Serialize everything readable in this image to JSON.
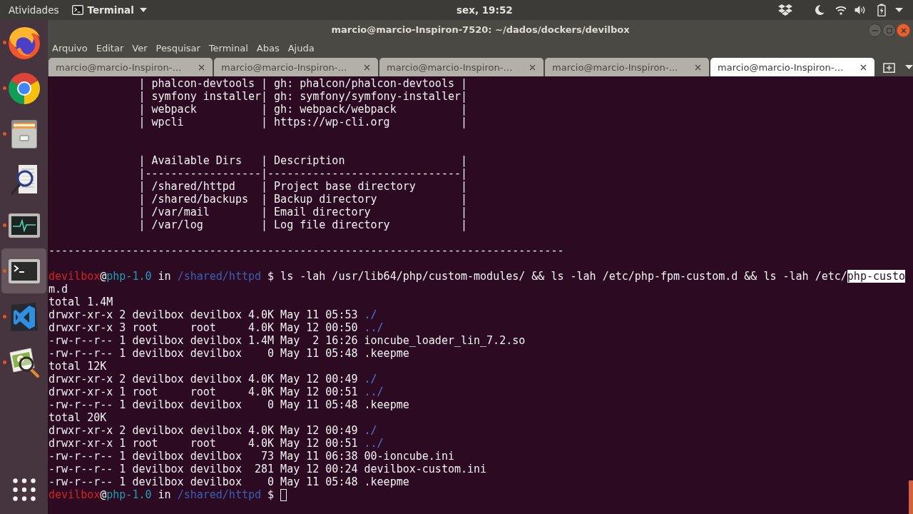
{
  "top_bar": {
    "activities": "Atividades",
    "app_menu": "Terminal",
    "clock": "sex, 19:52"
  },
  "dock": {
    "items": [
      {
        "kind": "fox",
        "running": true,
        "selected": false
      },
      {
        "kind": "ring",
        "running": true,
        "selected": false
      },
      {
        "kind": "cabinet",
        "running": true,
        "selected": false
      },
      {
        "kind": "scanner",
        "running": false,
        "selected": false
      },
      {
        "kind": "monitor",
        "running": true,
        "selected": false
      },
      {
        "kind": "prompt",
        "running": true,
        "selected": true
      },
      {
        "kind": "editor",
        "running": true,
        "selected": false
      },
      {
        "kind": "viewer",
        "running": true,
        "selected": false
      }
    ]
  },
  "window": {
    "title": "marcio@marcio-Inspiron-7520: ~/dados/dockers/devilbox"
  },
  "menu": [
    "Arquivo",
    "Editar",
    "Ver",
    "Pesquisar",
    "Terminal",
    "Abas",
    "Ajuda"
  ],
  "tabs": [
    {
      "label": "marcio@marcio-Inspiron-…",
      "selected": false
    },
    {
      "label": "marcio@marcio-Inspiron-…",
      "selected": false
    },
    {
      "label": "marcio@marcio-Inspiron-…",
      "selected": false
    },
    {
      "label": "marcio@marcio-Inspiron-…",
      "selected": false
    },
    {
      "label": "marcio@marcio-Inspiron-…",
      "selected": true
    }
  ],
  "terminal": {
    "lines": [
      {
        "kind": "text",
        "text": "              | phalcon-devtools | gh: phalcon/phalcon-devtools |"
      },
      {
        "kind": "text",
        "text": "              | symfony installer| gh: symfony/symfony-installer|"
      },
      {
        "kind": "text",
        "text": "              | webpack          | gh: webpack/webpack          |"
      },
      {
        "kind": "text",
        "text": "              | wpcli            | https://wp-cli.org           |"
      },
      {
        "kind": "blank"
      },
      {
        "kind": "blank"
      },
      {
        "kind": "text",
        "text": "              | Available Dirs   | Description                  |"
      },
      {
        "kind": "text",
        "text": "              |------------------|------------------------------|"
      },
      {
        "kind": "text",
        "text": "              | /shared/httpd    | Project base directory       |"
      },
      {
        "kind": "text",
        "text": "              | /shared/backups  | Backup directory             |"
      },
      {
        "kind": "text",
        "text": "              | /var/mail        | Email directory              |"
      },
      {
        "kind": "text",
        "text": "              | /var/log         | Log file directory           |"
      },
      {
        "kind": "blank"
      },
      {
        "kind": "text",
        "text": "--------------------------------------------------------------------------------"
      },
      {
        "kind": "blank"
      },
      {
        "kind": "colored",
        "segments": [
          {
            "kind": "user",
            "text": "devilbox"
          },
          {
            "kind": "plain",
            "text": "@"
          },
          {
            "kind": "host",
            "text": "php-1.0"
          },
          {
            "kind": "plain",
            "text": " in "
          },
          {
            "kind": "path",
            "text": "/shared/httpd"
          },
          {
            "kind": "plain",
            "text": " $ ls -lah /usr/lib64/php/custom-modules/ && ls -lah /etc/php-fpm-custom.d && ls -lah /etc/"
          },
          {
            "kind": "highlight",
            "text": "php-custo"
          }
        ]
      },
      {
        "kind": "text",
        "text": "m.d"
      },
      {
        "kind": "text",
        "text": "total 1.4M"
      },
      {
        "kind": "colored",
        "segments": [
          {
            "kind": "plain",
            "text": "drwxr-xr-x 2 devilbox devilbox 4.0K May 11 05:53 "
          },
          {
            "kind": "dir",
            "text": "./"
          }
        ]
      },
      {
        "kind": "colored",
        "segments": [
          {
            "kind": "plain",
            "text": "drwxr-xr-x 3 root     root     4.0K May 12 00:50 "
          },
          {
            "kind": "dir",
            "text": "../"
          }
        ]
      },
      {
        "kind": "text",
        "text": "-rw-r--r-- 1 devilbox devilbox 1.4M May  2 16:26 ioncube_loader_lin_7.2.so"
      },
      {
        "kind": "text",
        "text": "-rw-r--r-- 1 devilbox devilbox    0 May 11 05:48 .keepme"
      },
      {
        "kind": "text",
        "text": "total 12K"
      },
      {
        "kind": "colored",
        "segments": [
          {
            "kind": "plain",
            "text": "drwxr-xr-x 2 devilbox devilbox 4.0K May 12 00:49 "
          },
          {
            "kind": "dir",
            "text": "./"
          }
        ]
      },
      {
        "kind": "colored",
        "segments": [
          {
            "kind": "plain",
            "text": "drwxr-xr-x 1 root     root     4.0K May 12 00:51 "
          },
          {
            "kind": "dir",
            "text": "../"
          }
        ]
      },
      {
        "kind": "text",
        "text": "-rw-r--r-- 1 devilbox devilbox    0 May 11 05:48 .keepme"
      },
      {
        "kind": "text",
        "text": "total 20K"
      },
      {
        "kind": "colored",
        "segments": [
          {
            "kind": "plain",
            "text": "drwxr-xr-x 2 devilbox devilbox 4.0K May 12 00:49 "
          },
          {
            "kind": "dir",
            "text": "./"
          }
        ]
      },
      {
        "kind": "colored",
        "segments": [
          {
            "kind": "plain",
            "text": "drwxr-xr-x 1 root     root     4.0K May 12 00:51 "
          },
          {
            "kind": "dir",
            "text": "../"
          }
        ]
      },
      {
        "kind": "text",
        "text": "-rw-r--r-- 1 devilbox devilbox   73 May 11 06:38 00-ioncube.ini"
      },
      {
        "kind": "text",
        "text": "-rw-r--r-- 1 devilbox devilbox  281 May 12 00:24 devilbox-custom.ini"
      },
      {
        "kind": "text",
        "text": "-rw-r--r-- 1 devilbox devilbox    0 May 11 05:48 .keepme"
      },
      {
        "kind": "colored",
        "segments": [
          {
            "kind": "user",
            "text": "devilbox"
          },
          {
            "kind": "plain",
            "text": "@"
          },
          {
            "kind": "host",
            "text": "php-1.0"
          },
          {
            "kind": "plain",
            "text": " in "
          },
          {
            "kind": "path",
            "text": "/shared/httpd"
          },
          {
            "kind": "plain",
            "text": " $ "
          }
        ]
      }
    ]
  }
}
